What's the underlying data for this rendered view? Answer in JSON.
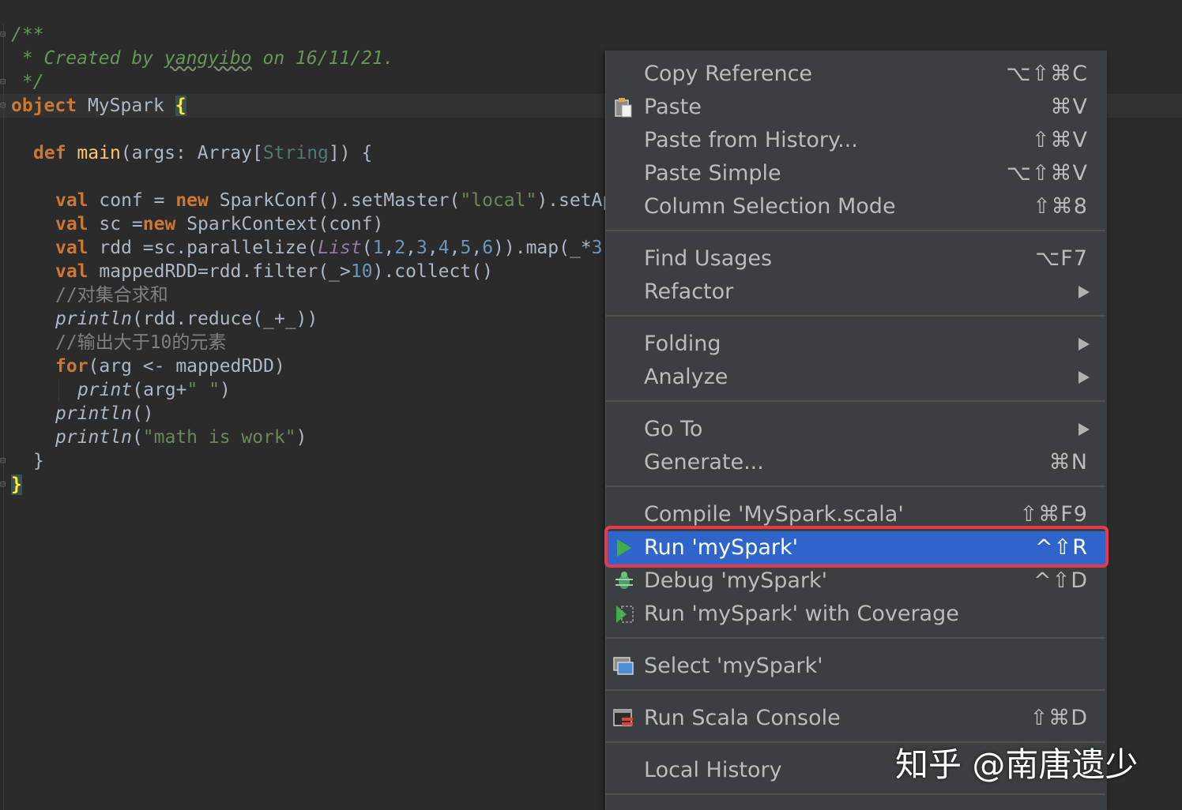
{
  "editor": {
    "doc_open": "/**",
    "doc_star": " * ",
    "doc_created": "Created by ",
    "doc_author": "yangyibo",
    "doc_on": " on 16/11/21.",
    "doc_close": " */",
    "obj_kw": "object",
    "obj_name": " MySpark ",
    "obj_brace": "{",
    "def_kw": "def",
    "main_name": "main",
    "main_args": "(args: Array[",
    "main_type": "String",
    "main_tail": "]) {",
    "val": "val",
    "new": "new",
    "conf_a": " conf = ",
    "conf_b": " SparkConf().setMaster(",
    "conf_str": "\"local\"",
    "conf_c": ").setAppN",
    "sc_a": " sc =",
    "sc_b": " SparkContext(conf)",
    "rdd_a": " rdd =sc.parallelize(",
    "rdd_list": "List",
    "rdd_open": "(",
    "rdd_nums": [
      "1",
      "2",
      "3",
      "4",
      "5",
      "6"
    ],
    "comma": ",",
    "rdd_b": ")).map(_*",
    "rdd_c": "3",
    "mapped_a": " mappedRDD=rdd.filter(_>",
    "mapped_num": "10",
    "mapped_b": ").collect()",
    "comment1": "//对集合求和",
    "println": "println",
    "reduce_args": "(rdd.reduce(_+_))",
    "comment2": "//输出大于10的元素",
    "for_kw": "for",
    "for_args": "(arg <- mappedRDD)",
    "print": "print",
    "print_args_a": "(arg+",
    "print_str": "\" \"",
    "print_args_b": ")",
    "println_empty": "()",
    "math_open": "(",
    "math_str": "\"math is work\"",
    "math_close": ")",
    "close_main": "}",
    "close_obj": "}"
  },
  "context_menu": {
    "items": [
      {
        "label": "Copy Reference",
        "shortcut": "⌥⇧⌘C"
      },
      {
        "label": "Paste",
        "shortcut": "⌘V",
        "icon": "clipboard-icon"
      },
      {
        "label": "Paste from History...",
        "shortcut": "⇧⌘V"
      },
      {
        "label": "Paste Simple",
        "shortcut": "⌥⇧⌘V"
      },
      {
        "label": "Column Selection Mode",
        "shortcut": "⇧⌘8"
      },
      {
        "label": "Find Usages",
        "shortcut": "⌥F7"
      },
      {
        "label": "Refactor",
        "submenu": true
      },
      {
        "label": "Folding",
        "submenu": true
      },
      {
        "label": "Analyze",
        "submenu": true
      },
      {
        "label": "Go To",
        "submenu": true
      },
      {
        "label": "Generate...",
        "shortcut": "⌘N"
      },
      {
        "label": "Compile 'MySpark.scala'",
        "shortcut": "⇧⌘F9"
      },
      {
        "label": "Run 'mySpark'",
        "shortcut": "^⇧R",
        "icon": "run-icon",
        "selected": true
      },
      {
        "label": "Debug 'mySpark'",
        "shortcut": "^⇧D",
        "icon": "debug-icon"
      },
      {
        "label": "Run 'mySpark' with Coverage",
        "icon": "coverage-icon"
      },
      {
        "label": "Select 'mySpark'",
        "icon": "run-config-icon"
      },
      {
        "label": "Run Scala Console",
        "shortcut": "⇧⌘D",
        "icon": "scala-console-icon"
      },
      {
        "label": "Local History"
      }
    ]
  },
  "watermark": "知乎 @南唐遗少",
  "colors": {
    "editor_bg": "#2b2b2b",
    "menu_bg": "#3c3f41",
    "menu_selected": "#2f65ca",
    "highlight_border": "#e63a4c",
    "keyword": "#cc7832",
    "string": "#6a8759",
    "number": "#6897bb",
    "doc_comment": "#629755"
  }
}
